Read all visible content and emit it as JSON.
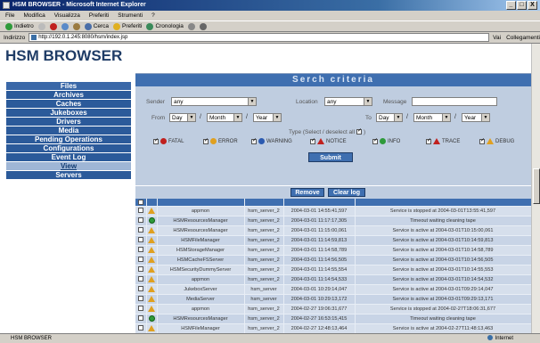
{
  "window": {
    "title": "HSM BROWSER - Microsoft Internet Explorer",
    "controls": [
      "_",
      "□",
      "X"
    ]
  },
  "menu": [
    "File",
    "Modifica",
    "Visualizza",
    "Preferiti",
    "Strumenti",
    "?"
  ],
  "toolbar": {
    "back": "Indietro",
    "search": "Cerca",
    "favorites": "Preferiti",
    "history": "Cronologia"
  },
  "address": {
    "label": "Indirizzo",
    "url": "http://192.0.1.245:8080/hsm/index.jsp",
    "go": "Vai",
    "links": "Collegamenti"
  },
  "app_title": "HSM BROWSER",
  "nav": [
    "Files",
    "Archives",
    "Caches",
    "Jukeboxes",
    "Drivers",
    "Media",
    "Pending Operations",
    "Configurations",
    "Event Log",
    "View",
    "Servers"
  ],
  "criteria": {
    "header": "Serch criteria",
    "sender_label": "Sender",
    "sender_value": "any",
    "location_label": "Location",
    "location_value": "any",
    "message_label": "Message",
    "from_label": "From",
    "to_label": "To",
    "day": "Day",
    "month": "Month",
    "year": "Year",
    "type_label": "Type  (Select / deselect all",
    "types": [
      "FATAL",
      "ERROR",
      "WARNING",
      "NOTICE",
      "INFO",
      "TRACE",
      "DEBUG"
    ],
    "type_colors": [
      "#c0201e",
      "#e0a020",
      "#2b5ab0",
      "#c0201e",
      "#2e9a3a",
      "#c0201e",
      "#e0a020"
    ],
    "submit": "Submit"
  },
  "results": {
    "remove": "Remove",
    "clear": "Clear log",
    "rows": [
      {
        "sev": "warn",
        "sender": "appmon",
        "location": "hsm_server_2",
        "time": "2004-03-01 14:55:41,597",
        "message": "Service is stopped at 2004-03-01T13:55:41,597"
      },
      {
        "sev": "ok",
        "sender": "HSMResourcesManager",
        "location": "hsm_server_2",
        "time": "2004-03-01 11:17:17,305",
        "message": "Timeout waiting cleaning tape"
      },
      {
        "sev": "warn",
        "sender": "HSMResourcesManager",
        "location": "hsm_server_2",
        "time": "2004-03-01 11:15:00,061",
        "message": "Service is active at 2004-03-01T10:15:00,061"
      },
      {
        "sev": "warn",
        "sender": "HSMFileManager",
        "location": "hsm_server_2",
        "time": "2004-03-01 11:14:59,813",
        "message": "Service is active at 2004-03-01T10:14:59,813"
      },
      {
        "sev": "warn",
        "sender": "HSMStorageManager",
        "location": "hsm_server_2",
        "time": "2004-03-01 11:14:58,789",
        "message": "Service is active at 2004-03-01T10:14:58,789"
      },
      {
        "sev": "warn",
        "sender": "HSMCacheFSServer",
        "location": "hsm_server_2",
        "time": "2004-03-01 11:14:56,505",
        "message": "Service is active at 2004-03-01T10:14:56,505"
      },
      {
        "sev": "warn",
        "sender": "HSMSecurityDummyServer",
        "location": "hsm_server_2",
        "time": "2004-03-01 11:14:55,554",
        "message": "Service is active at 2004-03-01T10:14:55,553"
      },
      {
        "sev": "warn",
        "sender": "appmon",
        "location": "hsm_server_2",
        "time": "2004-03-01 11:14:54,533",
        "message": "Service is active at 2004-03-01T10:14:54,532"
      },
      {
        "sev": "warn",
        "sender": "JukeboxServer",
        "location": "hsm_server",
        "time": "2004-03-01 10:29:14,047",
        "message": "Service is active at 2004-03-01T09:29:14,047"
      },
      {
        "sev": "warn",
        "sender": "MediaServer",
        "location": "hsm_server",
        "time": "2004-03-01 10:29:13,172",
        "message": "Service is active at 2004-03-01T09:29:13,171"
      },
      {
        "sev": "warn",
        "sender": "appmon",
        "location": "hsm_server_2",
        "time": "2004-02-27 19:06:31,677",
        "message": "Service is stopped at 2004-02-27T18:06:31,677"
      },
      {
        "sev": "ok",
        "sender": "HSMResourcesManager",
        "location": "hsm_server_2",
        "time": "2004-02-27 16:53:15,415",
        "message": "Timeout waiting cleaning tape"
      },
      {
        "sev": "warn",
        "sender": "HSMFileManager",
        "location": "hsm_server_2",
        "time": "2004-02-27 12:48:13,464",
        "message": "Service is active at 2004-02-27T11:48:13,463"
      }
    ]
  },
  "status": {
    "left": "HSM BROWSER",
    "zone": "Internet"
  }
}
